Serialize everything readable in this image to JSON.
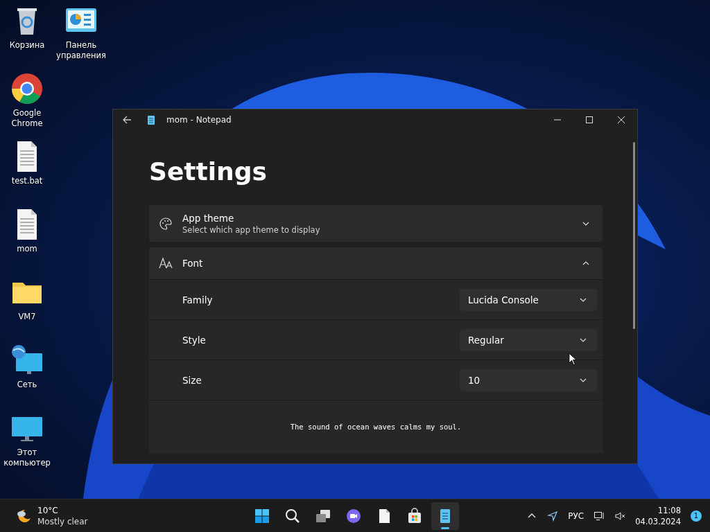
{
  "desktop_icons": [
    {
      "kind": "recycle",
      "label": "Корзина"
    },
    {
      "kind": "control-panel",
      "label": "Панель управления"
    },
    {
      "kind": "chrome",
      "label": "Google Chrome"
    },
    {
      "kind": "file",
      "label": "test.bat"
    },
    {
      "kind": "file",
      "label": "mom"
    },
    {
      "kind": "folder",
      "label": "VM7"
    },
    {
      "kind": "network",
      "label": "Сеть"
    },
    {
      "kind": "computer",
      "label": "Этот компьютер"
    }
  ],
  "window": {
    "title": "mom - Notepad",
    "heading": "Settings",
    "sections": [
      {
        "kind": "theme",
        "title": "App theme",
        "subtitle": "Select which app theme to display",
        "expanded": false
      },
      {
        "kind": "font",
        "title": "Font",
        "expanded": true,
        "settings": [
          {
            "label": "Family",
            "value": "Lucida Console"
          },
          {
            "label": "Style",
            "value": "Regular"
          },
          {
            "label": "Size",
            "value": "10"
          }
        ],
        "preview": "The sound of ocean waves calms my soul."
      }
    ]
  },
  "taskbar": {
    "weather": {
      "temperature": "10°C",
      "condition": "Mostly clear"
    },
    "apps": [
      {
        "kind": "start",
        "selected": false
      },
      {
        "kind": "search",
        "selected": false
      },
      {
        "kind": "task-view",
        "selected": false
      },
      {
        "kind": "chat",
        "selected": false
      },
      {
        "kind": "file",
        "selected": false
      },
      {
        "kind": "store",
        "selected": false
      },
      {
        "kind": "notepad",
        "selected": true
      }
    ],
    "language": "РУС",
    "time": "11:08",
    "date": "04.03.2024",
    "notification_count": "1"
  }
}
